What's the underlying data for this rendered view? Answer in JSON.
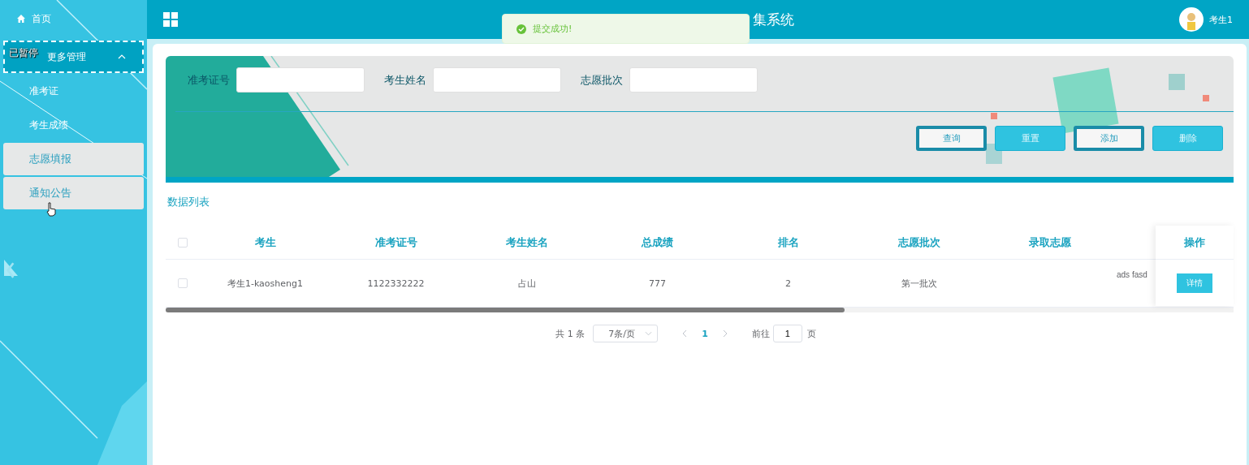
{
  "sidebar": {
    "items": [
      {
        "label": "首页",
        "kind": "link"
      },
      {
        "label": "更多管理",
        "kind": "group",
        "expanded": true,
        "children": [
          {
            "label": "准考证",
            "highlighted": false
          },
          {
            "label": "考生成绩",
            "highlighted": false
          },
          {
            "label": "志愿填报",
            "highlighted": true
          },
          {
            "label": "通知公告",
            "highlighted": true
          }
        ]
      }
    ]
  },
  "video_overlay": {
    "label": "已暂停"
  },
  "header": {
    "title": "集系统",
    "user": "考生1"
  },
  "toast": {
    "message": "提交成功!"
  },
  "search": {
    "fields": [
      {
        "label": "准考证号"
      },
      {
        "label": "考生姓名"
      },
      {
        "label": "志愿批次"
      }
    ],
    "buttons": [
      {
        "label": "查询",
        "kind": "outline"
      },
      {
        "label": "重置",
        "kind": "fill"
      },
      {
        "label": "添加",
        "kind": "outline"
      },
      {
        "label": "删除",
        "kind": "fill"
      }
    ]
  },
  "list_title": "数据列表",
  "table": {
    "columns": [
      "考生",
      "准考证号",
      "考生姓名",
      "总成绩",
      "排名",
      "志愿批次",
      "录取志愿"
    ],
    "header_checked": false,
    "rows": [
      {
        "checked": false,
        "cells": [
          "考生1-kaosheng1",
          "1122332222",
          "占山",
          "777",
          "2",
          "第一批次",
          ""
        ],
        "overflow": "ads fasd",
        "action": "详情"
      }
    ],
    "fixed_column": "操作"
  },
  "pagination": {
    "total": "共 1 条",
    "page_size": "7条/页",
    "pages": [
      {
        "label": "1",
        "selected": true
      }
    ],
    "goto_label": "前往",
    "goto_value": "1",
    "goto_suffix": "页"
  }
}
